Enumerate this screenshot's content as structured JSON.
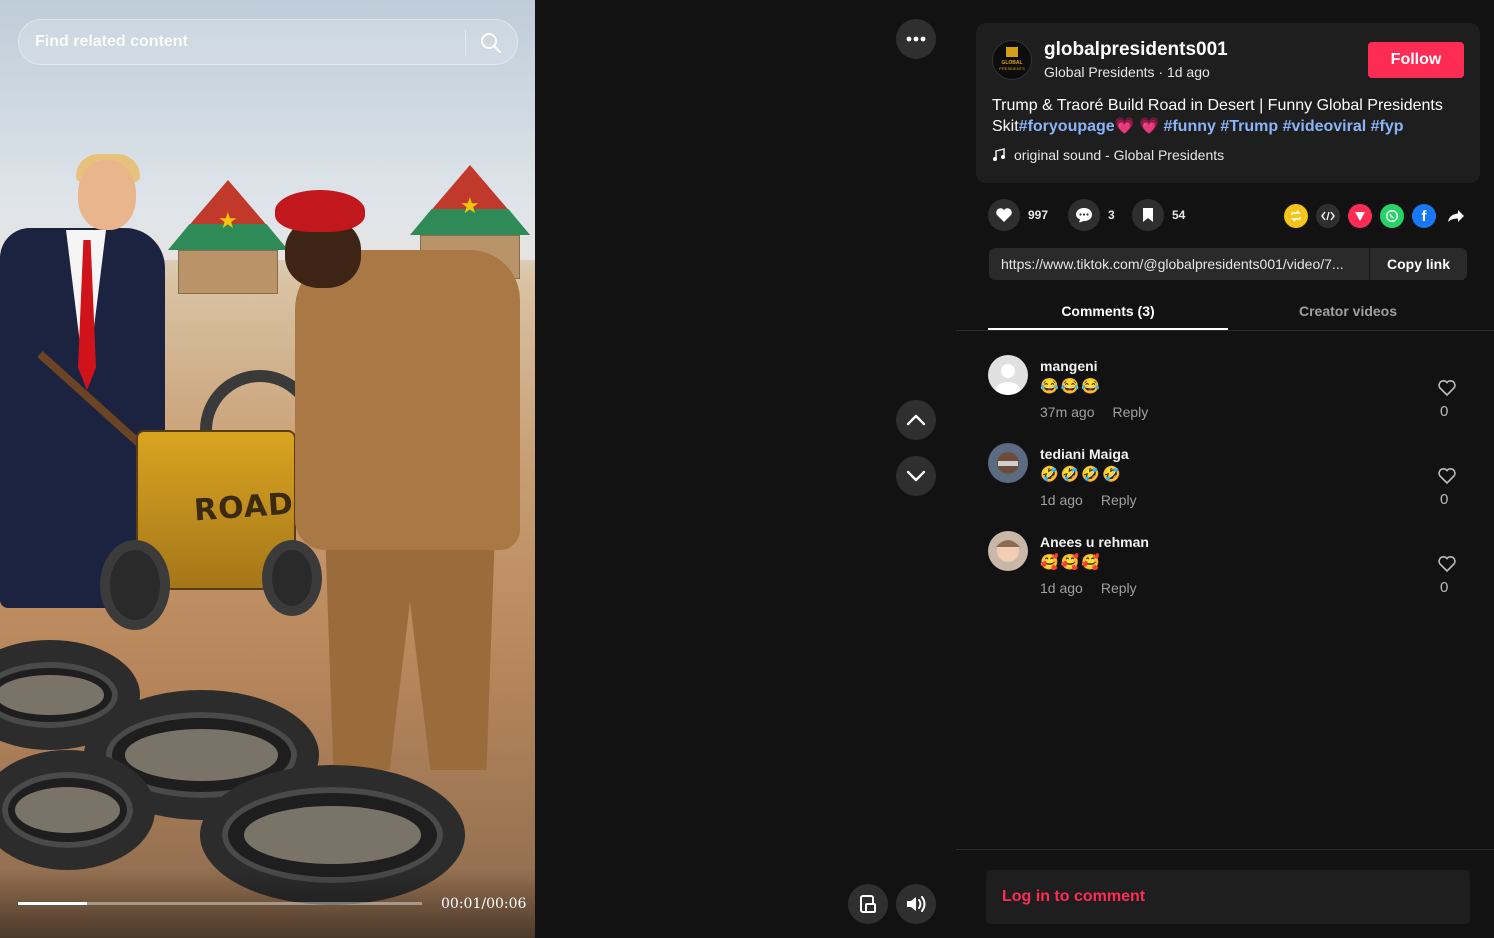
{
  "search": {
    "placeholder": "Find related content"
  },
  "video": {
    "machine_label": "ROAD",
    "time": "00:01/00:06",
    "progress": 0.17
  },
  "author": {
    "username": "globalpresidents001",
    "display_name": "Global Presidents",
    "posted": "1d ago",
    "avatar_text": "GLOBAL PRESIDENTS"
  },
  "follow_label": "Follow",
  "description": {
    "text": "Trump & Traoré Build Road in Desert | Funny Global Presidents Skit",
    "hashtags": [
      "#foryoupage",
      "#funny",
      "#Trump",
      "#videoviral",
      "#fyp"
    ],
    "hearts": "💗 💗"
  },
  "music": "original sound - Global Presidents",
  "stats": {
    "likes": "997",
    "comments": "3",
    "saves": "54"
  },
  "share_link": "https://www.tiktok.com/@globalpresidents001/video/7...",
  "copy_link_label": "Copy link",
  "tabs": [
    {
      "label": "Comments (3)",
      "active": true
    },
    {
      "label": "Creator videos",
      "active": false
    }
  ],
  "comments": [
    {
      "name": "mangeni",
      "emoji": "😂😂😂",
      "time": "37m ago",
      "reply": "Reply",
      "likes": "0"
    },
    {
      "name": "tediani Maiga",
      "emoji": "🤣🤣🤣🤣",
      "time": "1d ago",
      "reply": "Reply",
      "likes": "0"
    },
    {
      "name": "Anees u rehman",
      "emoji": "🥰🥰🥰",
      "time": "1d ago",
      "reply": "Reply",
      "likes": "0"
    }
  ],
  "login_prompt": "Log in to comment",
  "colors": {
    "accent": "#fe2c55",
    "hashtag": "#8ab4f8",
    "background": "#121212"
  }
}
